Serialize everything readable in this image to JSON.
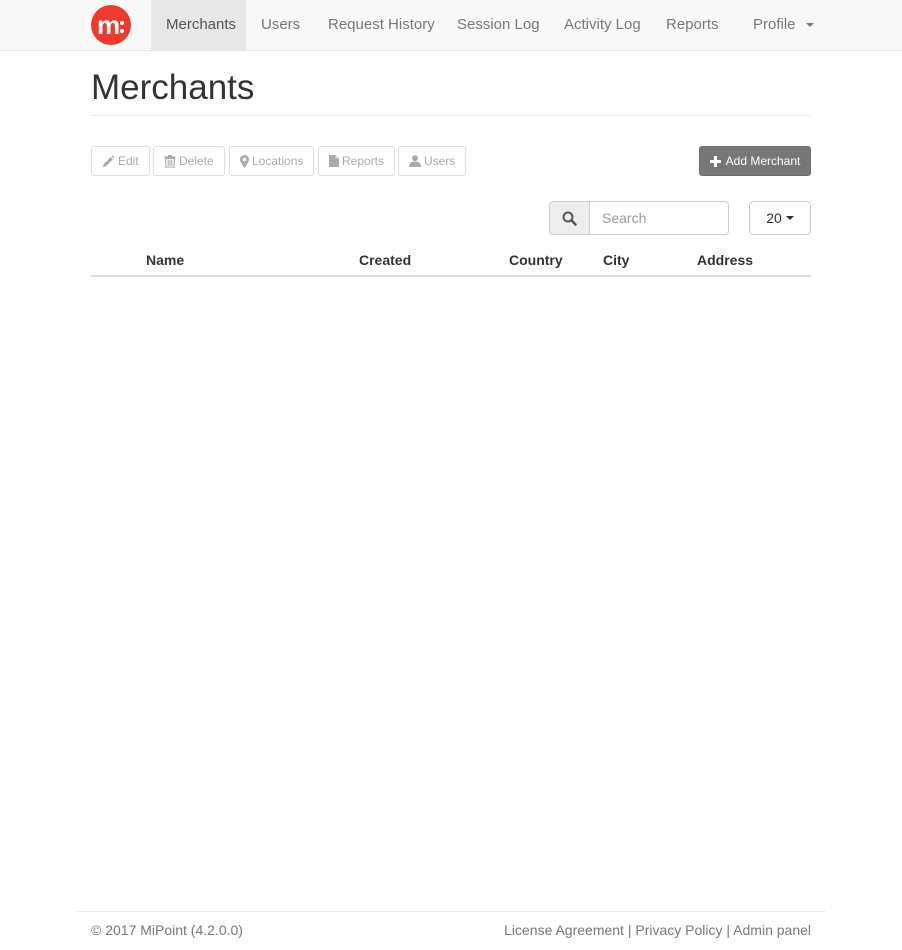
{
  "navbar": {
    "logo_letter": "m",
    "items": [
      {
        "label": "Merchants"
      },
      {
        "label": "Users"
      },
      {
        "label": "Request History"
      },
      {
        "label": "Session Log"
      },
      {
        "label": "Activity Log"
      },
      {
        "label": "Reports"
      }
    ],
    "profile_label": "Profile",
    "active_color": "#e7e7e7",
    "logo_color": "#ef3b2d"
  },
  "page": {
    "title": "Merchants"
  },
  "toolbar": {
    "edit_label": "Edit",
    "delete_label": "Delete",
    "locations_label": "Locations",
    "reports_label": "Reports",
    "users_label": "Users",
    "add_label": "Add Merchant"
  },
  "search": {
    "placeholder": "Search",
    "value": "",
    "page_size": "20"
  },
  "table": {
    "columns": [
      "Name",
      "Created",
      "Country",
      "City",
      "Address"
    ],
    "rows": []
  },
  "footer": {
    "copyright": "© 2017 MiPoint (4.2.0.0)",
    "links": [
      "License Agreement",
      "Privacy Policy",
      "Admin panel"
    ],
    "separator": " | "
  }
}
